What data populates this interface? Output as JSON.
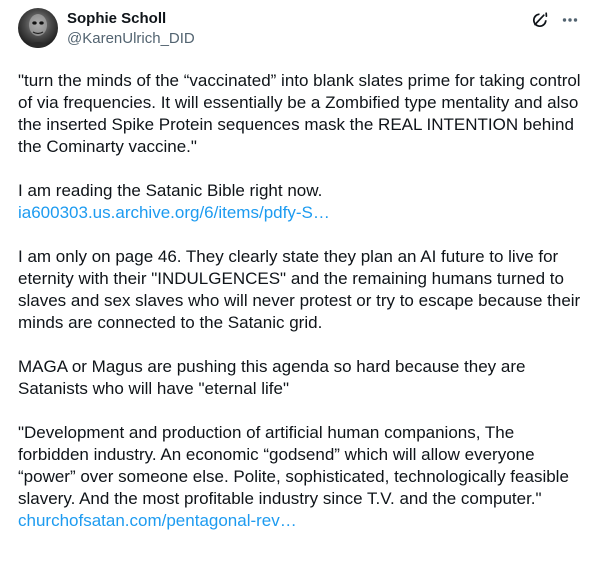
{
  "author": {
    "display_name": "Sophie Scholl",
    "handle": "@KarenUlrich_DID"
  },
  "icons": {
    "grok": "grok-icon",
    "more": "more-options-icon"
  },
  "colors": {
    "link": "#1d9bf0",
    "text": "#0f1419",
    "secondary": "#536471"
  },
  "tweet": {
    "p1": "\"turn the minds of the “vaccinated” into blank slates prime for taking control of via frequencies. It will essentially be a Zombified type mentality and also the inserted Spike Protein sequences mask the REAL INTENTION behind the Cominarty vaccine.\"",
    "p2_text": "I am reading the Satanic Bible right now.",
    "p2_link": "ia600303.us.archive.org/6/items/pdfy-S…",
    "p3": "I am only on page 46. They clearly state they plan an AI future to live for eternity with their \"INDULGENCES\" and the remaining humans turned to slaves and sex slaves who will never protest or try to escape because their minds are connected to the Satanic grid.",
    "p4": "MAGA or Magus are pushing this agenda so hard because they are Satanists who will have \"eternal life\"",
    "p5_text": "\"Development and production of artificial human companions, The forbidden industry. An economic “godsend” which will allow everyone “power” over someone else. Polite, sophisticated, technologically feasible slavery. And the most profitable industry since T.V. and the computer.\"",
    "p5_link": "churchofsatan.com/pentagonal-rev…"
  }
}
